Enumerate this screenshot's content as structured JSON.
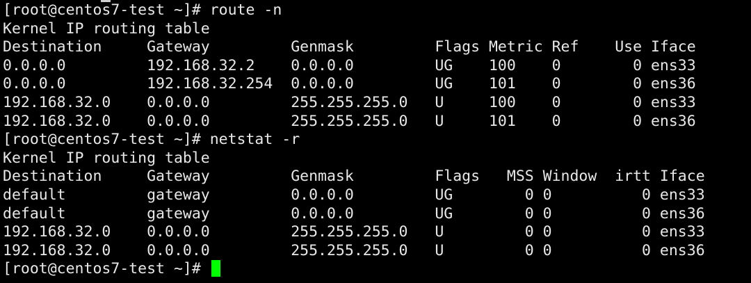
{
  "terminal": {
    "lines": [
      "[root@centos7-test ~]# route -n",
      "Kernel IP routing table",
      "Destination     Gateway         Genmask         Flags Metric Ref    Use Iface",
      "0.0.0.0         192.168.32.2    0.0.0.0         UG    100    0        0 ens33",
      "0.0.0.0         192.168.32.254  0.0.0.0         UG    101    0        0 ens36",
      "192.168.32.0    0.0.0.0         255.255.255.0   U     100    0        0 ens33",
      "192.168.32.0    0.0.0.0         255.255.255.0   U     101    0        0 ens36",
      "[root@centos7-test ~]# netstat -r",
      "Kernel IP routing table",
      "Destination     Gateway         Genmask         Flags   MSS Window  irtt Iface",
      "default         gateway         0.0.0.0         UG        0 0          0 ens33",
      "default         gateway         0.0.0.0         UG        0 0          0 ens36",
      "192.168.32.0    0.0.0.0         255.255.255.0   U         0 0          0 ens33",
      "192.168.32.0    0.0.0.0         255.255.255.0   U         0 0          0 ens36"
    ],
    "prompt": "[root@centos7-test ~]# ",
    "colors": {
      "background": "#000000",
      "foreground": "#e8e8e8",
      "cursor": "#00ff00"
    }
  }
}
